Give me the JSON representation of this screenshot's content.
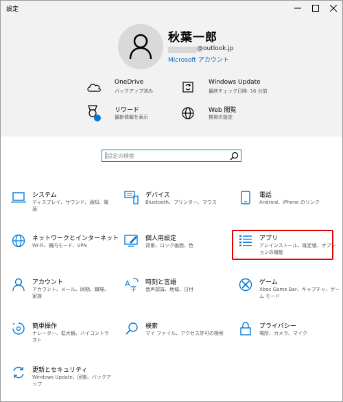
{
  "window": {
    "title": "設定"
  },
  "profile": {
    "name": "秋葉一郎",
    "email_suffix": "@outlook.jp",
    "account_link": "Microsoft アカウント"
  },
  "header_items": [
    {
      "title": "OneDrive",
      "subtitle": "バックアップ済み",
      "icon": "cloud-icon"
    },
    {
      "title": "Windows Update",
      "subtitle": "最終チェック日時: 16 分前",
      "icon": "update-icon"
    },
    {
      "title": "リワード",
      "subtitle": "最新情報を表示",
      "icon": "rewards-icon"
    },
    {
      "title": "Web 閲覧",
      "subtitle": "推奨の設定",
      "icon": "globe-icon"
    }
  ],
  "search": {
    "placeholder": "設定の検索"
  },
  "categories": [
    {
      "title": "システム",
      "subtitle": "ディスプレイ、サウンド、通知、電源",
      "icon": "laptop-icon"
    },
    {
      "title": "デバイス",
      "subtitle": "Bluetooth、プリンター、マウス",
      "icon": "keyboard-icon"
    },
    {
      "title": "電話",
      "subtitle": "Android、iPhone のリンク",
      "icon": "phone-icon"
    },
    {
      "title": "ネットワークとインターネット",
      "subtitle": "Wi-Fi、機内モード、VPN",
      "icon": "globe-icon"
    },
    {
      "title": "個人用設定",
      "subtitle": "背景、ロック画面、色",
      "icon": "paint-icon"
    },
    {
      "title": "アプリ",
      "subtitle": "アンインストール、既定値、オプションの機能",
      "icon": "apps-list-icon"
    },
    {
      "title": "アカウント",
      "subtitle": "アカウント、メール、同期、職場、家族",
      "icon": "person-icon"
    },
    {
      "title": "時刻と言語",
      "subtitle": "音声認識、地域、日付",
      "icon": "time-language-icon"
    },
    {
      "title": "ゲーム",
      "subtitle": "Xbox Game Bar、キャプチャ、ゲーム モード",
      "icon": "xbox-icon"
    },
    {
      "title": "簡単操作",
      "subtitle": "ナレーター、拡大鏡、ハイコントラスト",
      "icon": "ease-of-access-icon"
    },
    {
      "title": "検索",
      "subtitle": "マイ ファイル、アクセス許可の検索",
      "icon": "search-icon"
    },
    {
      "title": "プライバシー",
      "subtitle": "場所、カメラ、マイク",
      "icon": "lock-icon"
    },
    {
      "title": "更新とセキュリティ",
      "subtitle": "Windows Update、回復、バックアップ",
      "icon": "sync-icon"
    }
  ],
  "colors": {
    "accent": "#0078d7",
    "highlight": "#e00000",
    "header_bg": "#f2f2f2"
  }
}
